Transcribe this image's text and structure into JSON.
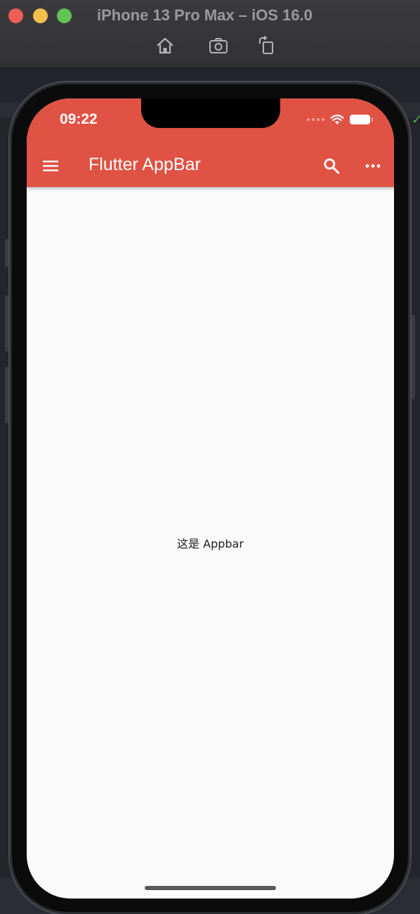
{
  "simulator": {
    "window_title": "iPhone 13 Pro Max – iOS 16.0",
    "toolbar": {
      "icons": [
        "home-icon",
        "screenshot-icon",
        "rotate-icon"
      ]
    }
  },
  "status_bar": {
    "time": "09:22"
  },
  "app_bar": {
    "title": "Flutter AppBar",
    "background_color": "#e05243",
    "leading_icon": "menu-icon",
    "actions": [
      "search-icon",
      "more-horiz-icon"
    ]
  },
  "body": {
    "text": "这是 Appbar"
  }
}
